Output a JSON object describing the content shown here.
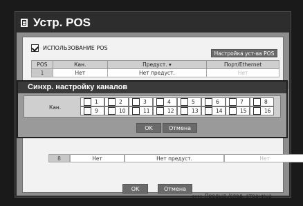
{
  "window": {
    "title": "Устр. POS"
  },
  "use_pos": {
    "label": "ИСПОЛЬЗОВАНИЕ POS",
    "checked": true
  },
  "setup_button": "Настройка уст-ва POS",
  "table": {
    "headers": [
      "POS",
      "Кан.",
      "Предуст. ▾",
      "Порт/Ethernet"
    ],
    "rows": [
      [
        "1",
        "Нет",
        "Нет предуст.",
        "Нет"
      ]
    ],
    "last_row": [
      "8",
      "Нет",
      "Нет предуст.",
      "Нет"
    ]
  },
  "pager": "◂◂ ▸▸ Предыд./след. страница",
  "ok": "OK",
  "cancel": "Отмена",
  "popup": {
    "title": "Синхр. настройку каналов",
    "label": "Кан.",
    "channels": [
      "1",
      "2",
      "3",
      "4",
      "5",
      "6",
      "7",
      "8",
      "9",
      "10",
      "11",
      "12",
      "13",
      "14",
      "15",
      "16"
    ],
    "ok": "OK",
    "cancel": "Отмена"
  }
}
